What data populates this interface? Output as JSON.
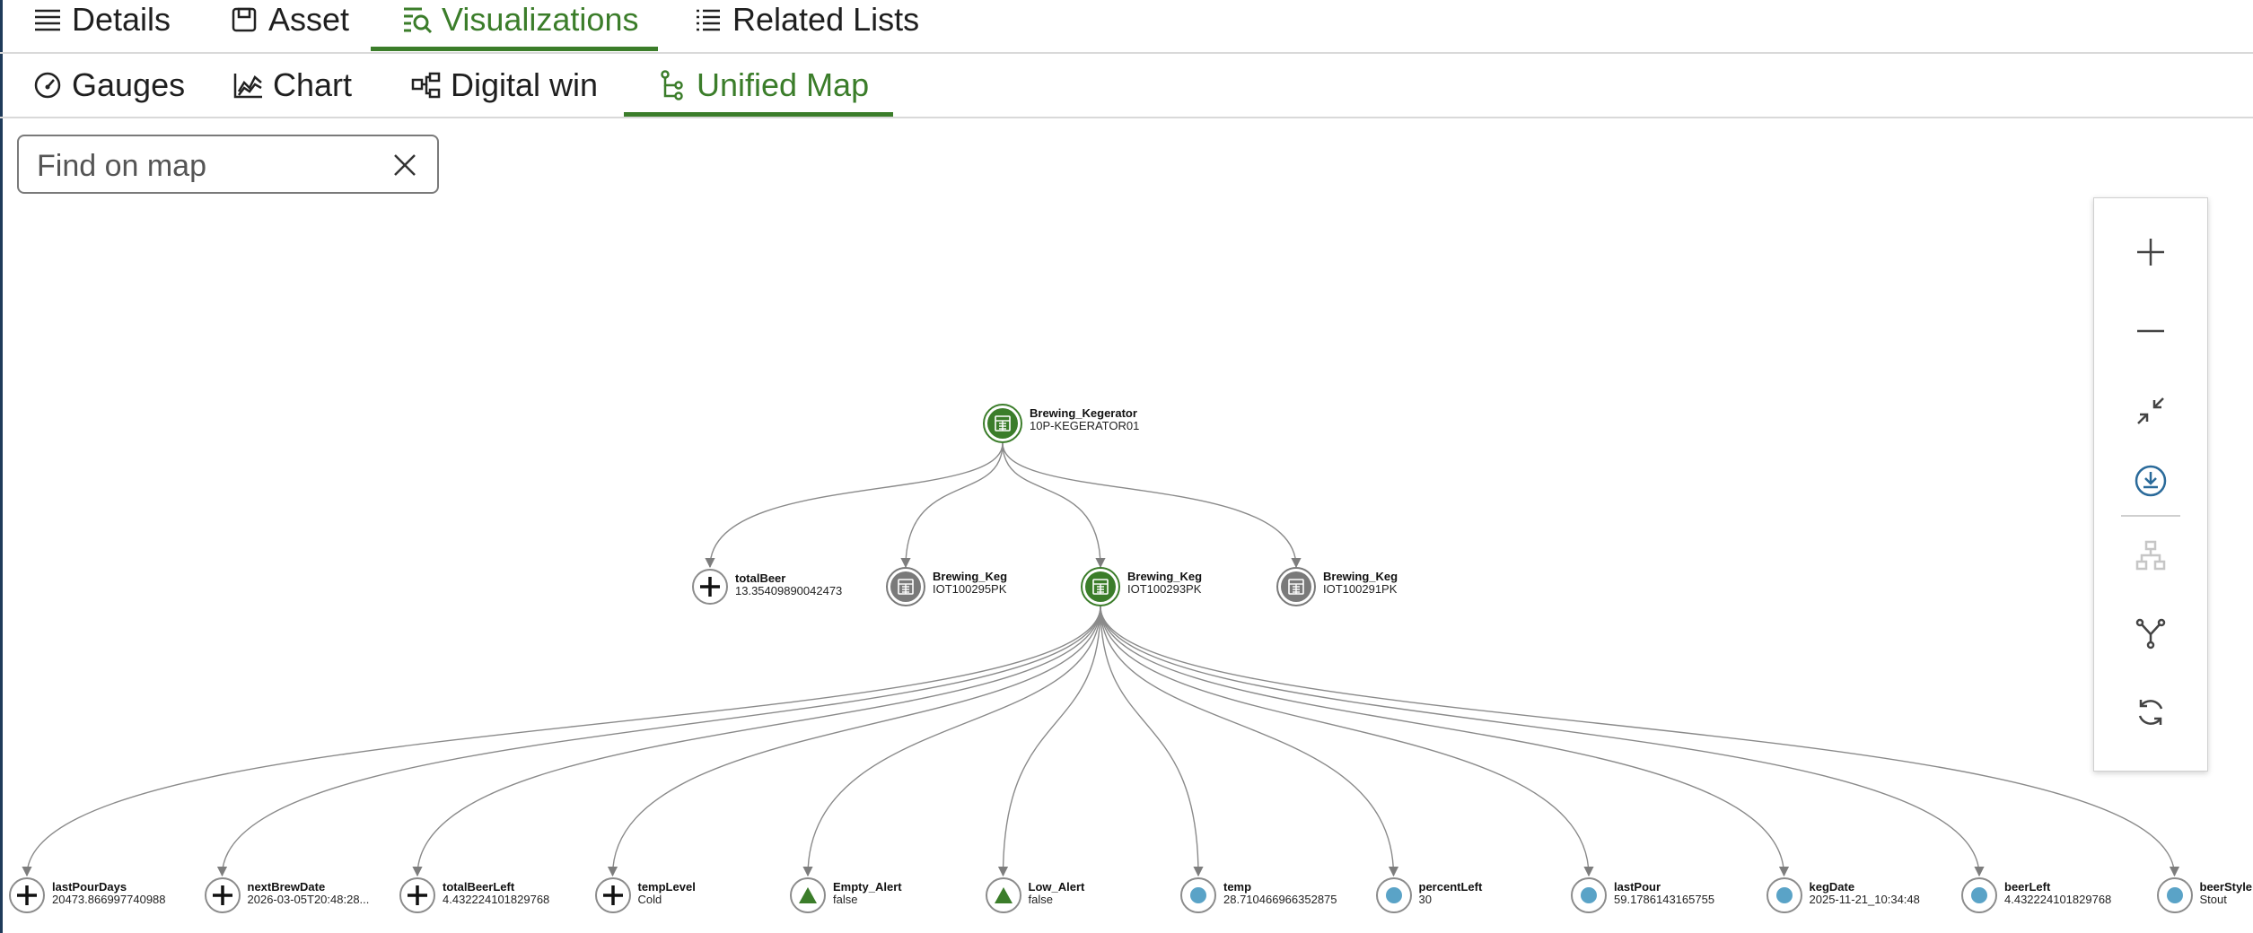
{
  "top_tabs": [
    {
      "label": "Details",
      "icon": "list-icon"
    },
    {
      "label": "Asset",
      "icon": "asset-icon"
    },
    {
      "label": "Visualizations",
      "icon": "visualizations-icon",
      "active": true
    },
    {
      "label": "Related Lists",
      "icon": "related-lists-icon"
    }
  ],
  "sub_tabs": [
    {
      "label": "Gauges",
      "icon": "gauge-icon"
    },
    {
      "label": "Chart",
      "icon": "chart-icon"
    },
    {
      "label": "Digital win",
      "icon": "digital-twin-icon"
    },
    {
      "label": "Unified Map",
      "icon": "unified-map-icon",
      "active": true
    }
  ],
  "search": {
    "placeholder": "Find on map",
    "value": ""
  },
  "tools": [
    "zoom-in-icon",
    "zoom-out-icon",
    "fit-to-screen-icon",
    "download-icon",
    "hierarchy-layout-icon",
    "branch-layout-icon",
    "refresh-icon"
  ],
  "colors": {
    "accent": "#3b7d2a",
    "node_gray": "#7a7a7a",
    "node_blue": "#5aa3c7",
    "edge": "#8a8a8a"
  },
  "map": {
    "root": {
      "name": "Brewing_Kegerator",
      "value": "10P-KEGERATOR01",
      "type": "asset-green"
    },
    "level1": [
      {
        "name": "totalBeer",
        "value": "13.35409890042473",
        "type": "plus"
      },
      {
        "name": "Brewing_Keg",
        "value": "IOT100295PK",
        "type": "asset-gray"
      },
      {
        "name": "Brewing_Keg",
        "value": "IOT100293PK",
        "type": "asset-green"
      },
      {
        "name": "Brewing_Keg",
        "value": "IOT100291PK",
        "type": "asset-gray"
      }
    ],
    "level2": [
      {
        "name": "lastPourDays",
        "value": "20473.866997740988",
        "type": "plus"
      },
      {
        "name": "nextBrewDate",
        "value": "2026-03-05T20:48:28...",
        "type": "plus"
      },
      {
        "name": "totalBeerLeft",
        "value": "4.432224101829768",
        "type": "plus"
      },
      {
        "name": "tempLevel",
        "value": "Cold",
        "type": "plus"
      },
      {
        "name": "Empty_Alert",
        "value": "false",
        "type": "triangle"
      },
      {
        "name": "Low_Alert",
        "value": "false",
        "type": "triangle"
      },
      {
        "name": "temp",
        "value": "28.710466966352875",
        "type": "dot"
      },
      {
        "name": "percentLeft",
        "value": "30",
        "type": "dot"
      },
      {
        "name": "lastPour",
        "value": "59.1786143165755",
        "type": "dot"
      },
      {
        "name": "kegDate",
        "value": "2025-11-21_10:34:48",
        "type": "dot"
      },
      {
        "name": "beerLeft",
        "value": "4.432224101829768",
        "type": "dot"
      },
      {
        "name": "beerStyle",
        "value": "Stout",
        "type": "dot"
      }
    ]
  }
}
